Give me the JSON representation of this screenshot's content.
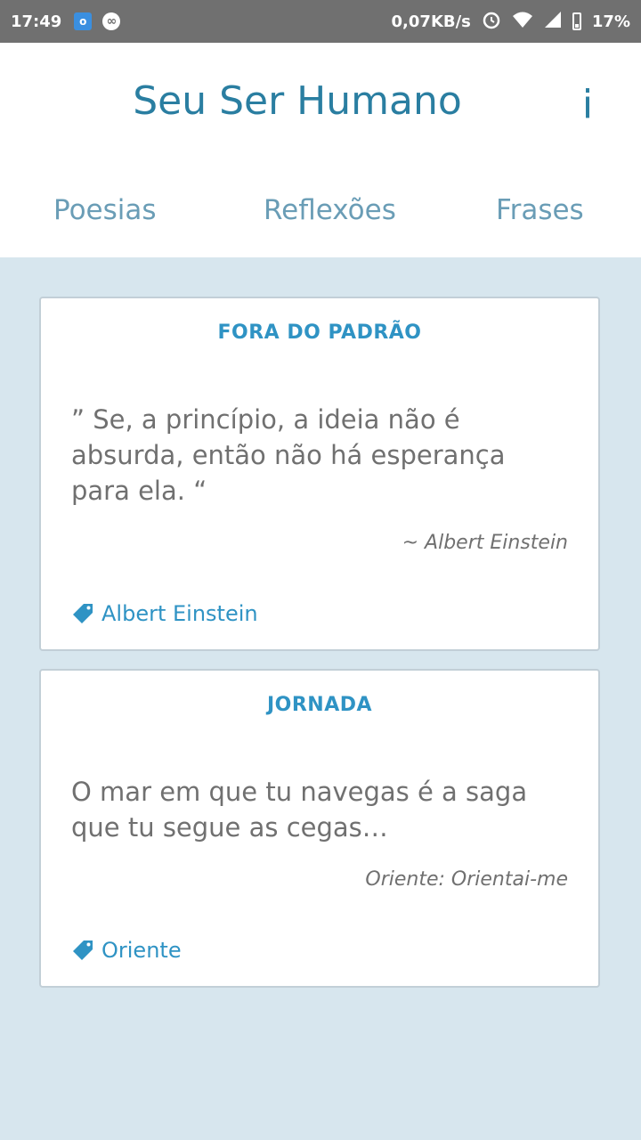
{
  "status_bar": {
    "time": "17:49",
    "network_speed": "0,07KB/s",
    "battery": "17%",
    "icons": [
      "outlook-icon",
      "loop-icon",
      "alarm-icon",
      "wifi-icon",
      "signal-icon",
      "battery-icon"
    ]
  },
  "header": {
    "title": "Seu Ser Humano",
    "info_label": "i"
  },
  "tabs": [
    {
      "label": "Poesias"
    },
    {
      "label": "Reflexões"
    },
    {
      "label": "Frases"
    }
  ],
  "cards": [
    {
      "title": "FORA DO PADRÃO",
      "quote": "” Se, a princípio, a ideia não é absurda, então não há esperança para ela. “",
      "author": "~ Albert Einstein",
      "tag": "Albert Einstein"
    },
    {
      "title": "JORNADA",
      "quote": "O mar em que tu navegas é a saga que tu segue as cegas…",
      "author": "Oriente: Orientai-me",
      "tag": "Oriente"
    }
  ],
  "colors": {
    "accent": "#2a7ea1",
    "tab_text": "#6a9db6",
    "card_title": "#2f93c4",
    "body_text": "#707070",
    "background": "#d7e6ee"
  }
}
